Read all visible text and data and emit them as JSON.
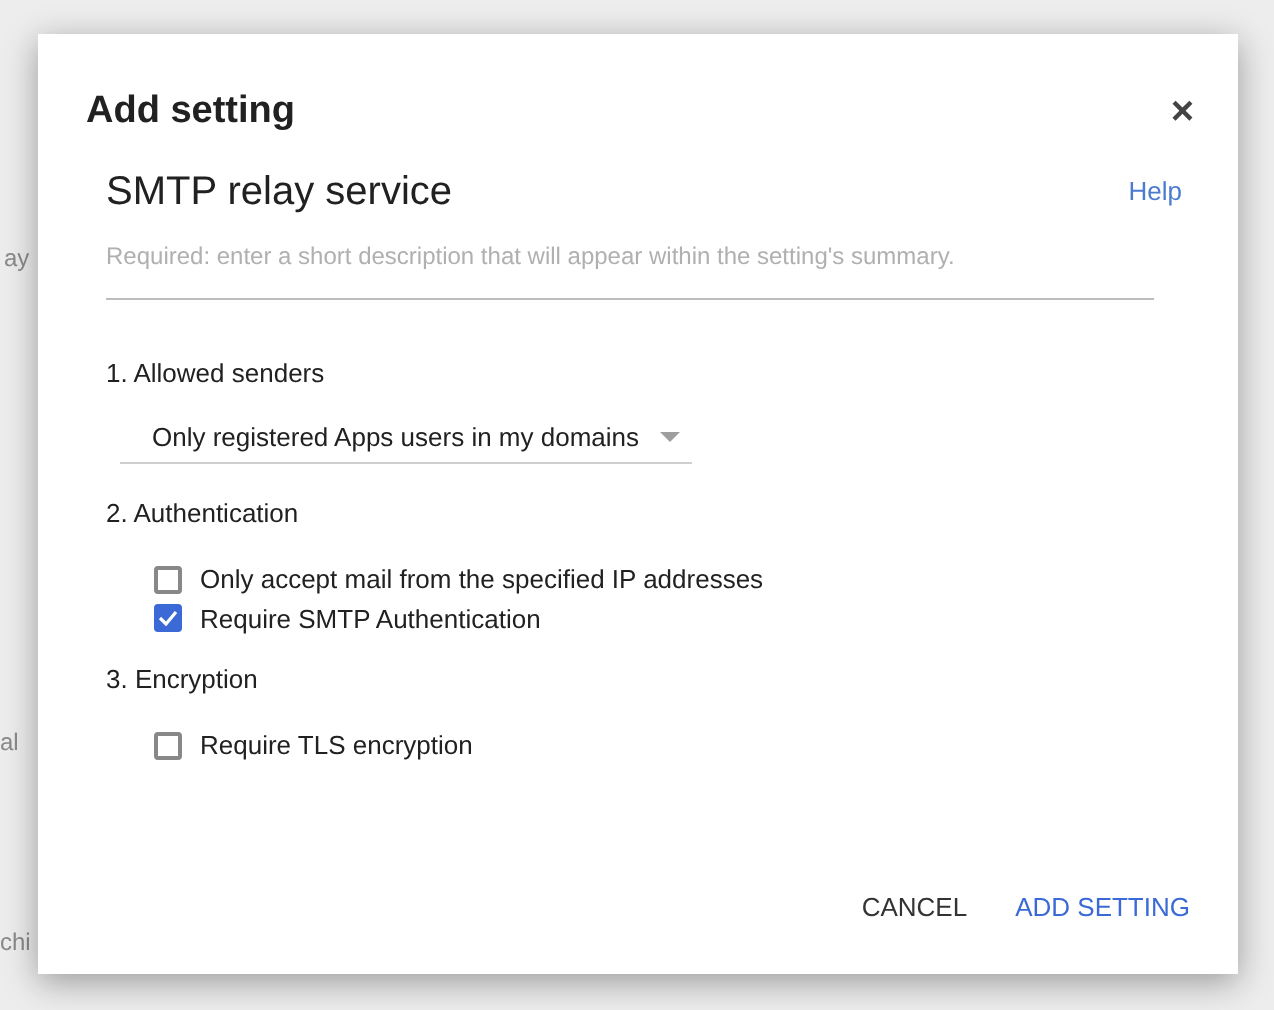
{
  "background_texts": [
    "ay",
    "al",
    "chi"
  ],
  "dialog": {
    "title": "Add setting",
    "close": "×",
    "setting_name": "SMTP relay service",
    "help": "Help",
    "description": {
      "placeholder": "Required: enter a short description that will appear within the setting's summary."
    },
    "sections": [
      {
        "kind": "dropdown",
        "label": "1. Allowed senders",
        "value": "Only registered Apps users in my domains"
      },
      {
        "kind": "checkboxes",
        "label": "2. Authentication",
        "options": [
          {
            "label": "Only accept mail from the specified IP addresses",
            "checked": false
          },
          {
            "label": "Require SMTP Authentication",
            "checked": true
          }
        ]
      },
      {
        "kind": "checkboxes",
        "label": "3. Encryption",
        "options": [
          {
            "label": "Require TLS encryption",
            "checked": false
          }
        ]
      }
    ],
    "buttons": [
      "CANCEL",
      "ADD SETTING"
    ]
  }
}
